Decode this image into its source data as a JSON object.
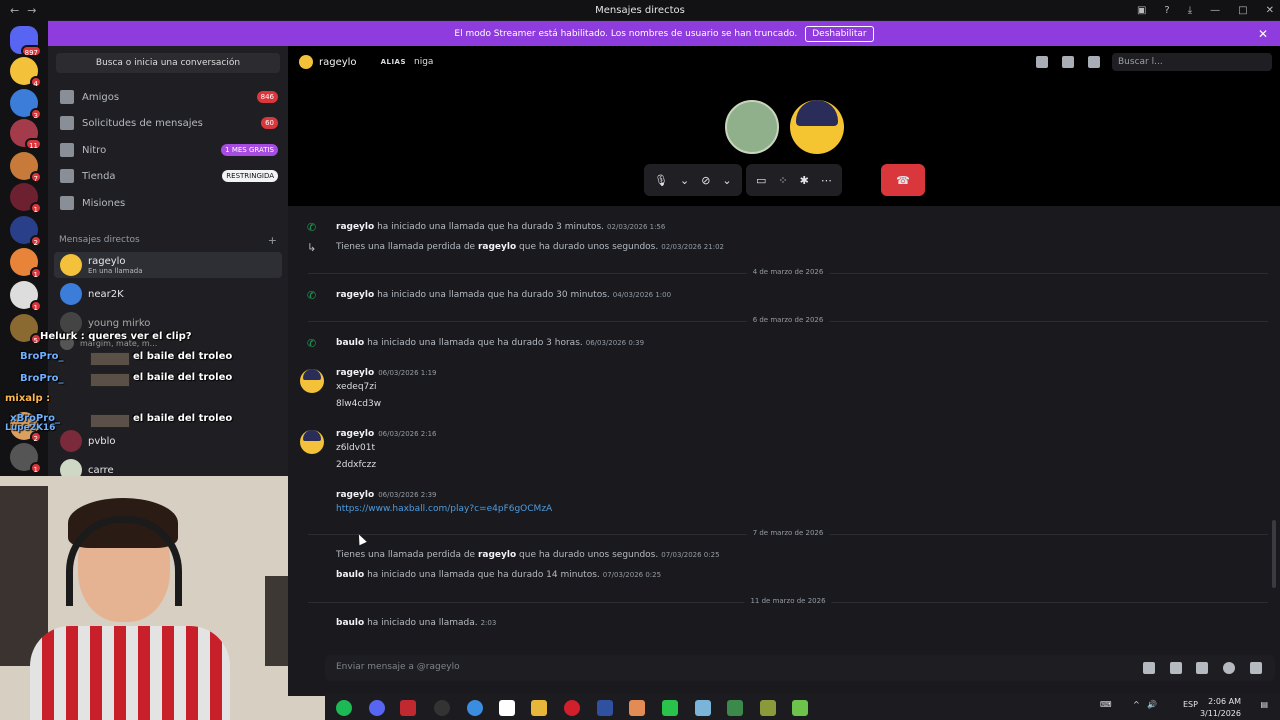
{
  "window": {
    "title": "Mensajes directos",
    "back": "←",
    "fwd": "→"
  },
  "banner": {
    "text": "El modo Streamer está habilitado. Los nombres de usuario se han truncado.",
    "button": "Deshabilitar"
  },
  "rail": {
    "home_badge": "897",
    "badges": [
      "4",
      "3",
      "11",
      "7",
      "1",
      "2",
      "1",
      "1",
      "5",
      "2",
      "1"
    ]
  },
  "sidebar": {
    "search": "Busca o inicia una conversación",
    "nav": [
      {
        "label": "Amigos",
        "pill": "846"
      },
      {
        "label": "Solicitudes de mensajes",
        "pill": "60"
      },
      {
        "label": "Nitro",
        "pill": "1 MES GRATIS"
      },
      {
        "label": "Tienda",
        "pill": "RESTRINGIDA"
      },
      {
        "label": "Misiones",
        "pill": ""
      }
    ],
    "dm_header": "Mensajes directos",
    "dms": [
      {
        "name": "rageylo",
        "status": "En una llamada"
      },
      {
        "name": "near2K",
        "status": ""
      },
      {
        "name": "young mirko",
        "status": ""
      },
      {
        "name": "margim, mate, m...",
        "status": ""
      },
      {
        "name": "pvblo",
        "status": ""
      },
      {
        "name": "carre",
        "status": ""
      }
    ]
  },
  "overlay": {
    "l1": "Helurk : queres ver el clip?",
    "l2_user": "BroPro_",
    "l2_msg": "el baile del troleo",
    "l3_user": "BroPro_",
    "l3_msg": "el baile del troleo",
    "l4_user": "mixalp :",
    "l5_user": "xBroPro_",
    "l5_msg": "el baile del troleo",
    "l6_user": "Lupe2K16"
  },
  "header": {
    "name": "rageylo",
    "alias_label": "ALIAS",
    "alias_value": "niga",
    "search": "Buscar l..."
  },
  "messages": {
    "m1_user": "rageylo",
    "m1_text": "ha iniciado una llamada que ha durado 3 minutos.",
    "m1_ts": "02/03/2026 1:56",
    "m2_pre": "Tienes una llamada perdida de",
    "m2_user": "rageylo",
    "m2_text": "que ha durado unos segundos.",
    "m2_ts": "02/03/2026 21:02",
    "d1": "4 de marzo de 2026",
    "m3_user": "rageylo",
    "m3_text": "ha iniciado una llamada que ha durado 30 minutos.",
    "m3_ts": "04/03/2026 1:00",
    "d2": "6 de marzo de 2026",
    "m4_user": "baulo",
    "m4_text": "ha iniciado una llamada que ha durado 3 horas.",
    "m4_ts": "06/03/2026 0:39",
    "g1_user": "rageylo",
    "g1_ts": "06/03/2026 1:19",
    "g1_l1": "xedeq7zi",
    "g1_l2": "8lw4cd3w",
    "g2_user": "rageylo",
    "g2_ts": "06/03/2026 2:16",
    "g2_l1": "z6ldv01t",
    "g2_l2": "2ddxfczz",
    "g3_user": "rageylo",
    "g3_ts": "06/03/2026 2:39",
    "g3_link": "https://www.haxball.com/play?c=e4pF6gOCMzA",
    "d3": "7 de marzo de 2026",
    "m5_pre": "Tienes una llamada perdida de",
    "m5_user": "rageylo",
    "m5_text": "que ha durado unos segundos.",
    "m5_ts": "07/03/2026 0:25",
    "m6_user": "baulo",
    "m6_text": "ha iniciado una llamada que ha durado 14 minutos.",
    "m6_ts": "07/03/2026 0:25",
    "d4": "11 de marzo de 2026",
    "m7_user": "baulo",
    "m7_text": "ha iniciado una llamada.",
    "m7_ts": "2:03"
  },
  "composer": {
    "placeholder": "Enviar mensaje a @rageylo"
  },
  "taskbar": {
    "lang": "ESP",
    "time": "2:06 AM",
    "date": "3/11/2026"
  },
  "colors": {
    "accent": "#8e3cde",
    "danger": "#da373c",
    "green": "#23a55a",
    "link": "#4f9bde"
  }
}
